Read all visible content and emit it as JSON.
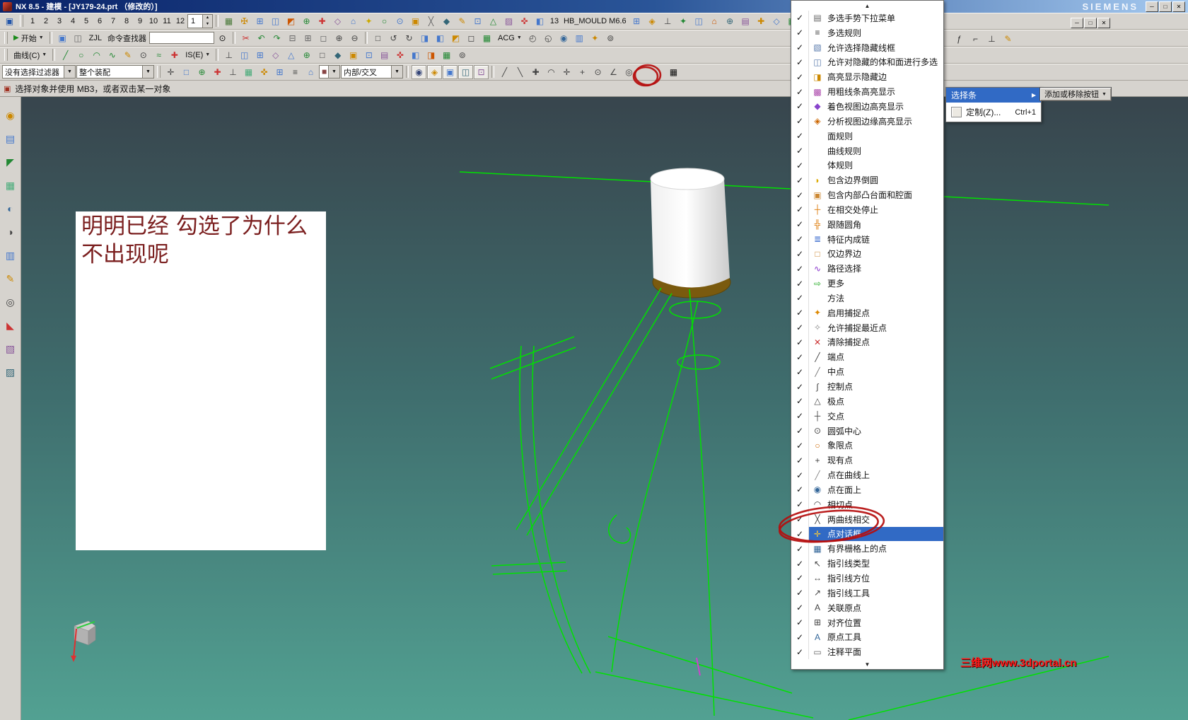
{
  "colors": {
    "highlight": "#316ac5",
    "wireframe": "#00e100",
    "annotation": "#b50d0d",
    "note_text": "#7b1f1f",
    "watermark": "#ff1a1a",
    "viewport_top": "#38454d",
    "viewport_mid": "#3f6e6e",
    "viewport_bottom": "#52a192"
  },
  "ui": {
    "dd_arrow": "▼",
    "spin_up": "▲",
    "spin_down": "▼",
    "start_glyph": "▶",
    "prompt_glyph": "▣",
    "search_glyph": "⊙"
  },
  "title_bar": {
    "app_title": "NX 8.5 - 建模 - [JY179-24.prt （修改的）]",
    "brand": "SIEMENS",
    "minimize": "─",
    "maximize": "□",
    "close": "✕"
  },
  "doc_window": {
    "minimize": "─",
    "restore": "□",
    "close": "✕"
  },
  "toolbar1": {
    "numbers": [
      "1",
      "2",
      "3",
      "4",
      "5",
      "6",
      "7",
      "8",
      "9",
      "10",
      "11",
      "12"
    ],
    "spinner_value": "1",
    "label_13": "13",
    "mould_label": "HB_MOULD M6.6",
    "icons_a": [
      {
        "g": "▦",
        "c": "#4a7a3a"
      },
      {
        "g": "✠",
        "c": "#cc8800"
      },
      {
        "g": "⊞",
        "c": "#4477cc"
      },
      {
        "g": "◫",
        "c": "#4477cc"
      },
      {
        "g": "◩",
        "c": "#cc5500"
      },
      {
        "g": "⊕",
        "c": "#228833"
      },
      {
        "g": "✚",
        "c": "#cc3333"
      },
      {
        "g": "◇",
        "c": "#885599"
      },
      {
        "g": "⌂",
        "c": "#4477cc"
      },
      {
        "g": "✦",
        "c": "#ccaa00"
      },
      {
        "g": "○",
        "c": "#228833"
      },
      {
        "g": "⊙",
        "c": "#4477cc"
      },
      {
        "g": "▣",
        "c": "#cc8800"
      },
      {
        "g": "╳",
        "c": "#666666"
      },
      {
        "g": "◆",
        "c": "#336677"
      },
      {
        "g": "✎",
        "c": "#cc8800"
      },
      {
        "g": "⊡",
        "c": "#4477cc"
      },
      {
        "g": "△",
        "c": "#228833"
      },
      {
        "g": "▨",
        "c": "#885599"
      },
      {
        "g": "✜",
        "c": "#cc3333"
      },
      {
        "g": "◧",
        "c": "#4477cc"
      }
    ],
    "icons_b": [
      {
        "g": "⊞",
        "c": "#4477cc"
      },
      {
        "g": "◈",
        "c": "#cc8800"
      },
      {
        "g": "⊥",
        "c": "#444444"
      },
      {
        "g": "✦",
        "c": "#228833"
      },
      {
        "g": "◫",
        "c": "#4477cc"
      },
      {
        "g": "⌂",
        "c": "#cc5500"
      },
      {
        "g": "⊕",
        "c": "#336677"
      },
      {
        "g": "▤",
        "c": "#885599"
      },
      {
        "g": "✚",
        "c": "#cc8800"
      },
      {
        "g": "◇",
        "c": "#4477cc"
      },
      {
        "g": "▦",
        "c": "#228833"
      }
    ]
  },
  "toolbar2": {
    "start_label": "开始",
    "zjl_label": "ZJL",
    "finder_label": "命令查找器",
    "acg_label": "ACG",
    "icons_a": [
      {
        "g": "▣",
        "c": "#4477cc"
      },
      {
        "g": "◫",
        "c": "#666666"
      }
    ],
    "icons_b": [
      {
        "g": "✂",
        "c": "#cc3333"
      },
      {
        "g": "↶",
        "c": "#228833"
      },
      {
        "g": "↷",
        "c": "#228833"
      },
      {
        "g": "⊟",
        "c": "#666666"
      },
      {
        "g": "⊞",
        "c": "#666666"
      },
      {
        "g": "◻",
        "c": "#666666"
      },
      {
        "g": "⊕",
        "c": "#444444"
      },
      {
        "g": "⊖",
        "c": "#444444"
      }
    ],
    "icons_c": [
      {
        "g": "□",
        "c": "#444444"
      },
      {
        "g": "↺",
        "c": "#444444"
      },
      {
        "g": "↻",
        "c": "#444444"
      },
      {
        "g": "◨",
        "c": "#4477cc"
      },
      {
        "g": "◧",
        "c": "#4477cc"
      },
      {
        "g": "◩",
        "c": "#cc8800"
      },
      {
        "g": "◻",
        "c": "#444444"
      },
      {
        "g": "▦",
        "c": "#228833"
      }
    ],
    "icons_d": [
      {
        "g": "◴",
        "c": "#444444"
      },
      {
        "g": "◵",
        "c": "#444444"
      },
      {
        "g": "◉",
        "c": "#336699"
      },
      {
        "g": "▥",
        "c": "#4477cc"
      },
      {
        "g": "✦",
        "c": "#cc8800"
      },
      {
        "g": "⊚",
        "c": "#444444"
      }
    ],
    "icons_right": [
      {
        "g": "ƒ",
        "c": "#333333"
      },
      {
        "g": "⌐",
        "c": "#333333"
      },
      {
        "g": "⊥",
        "c": "#333333"
      },
      {
        "g": "✎",
        "c": "#cc8800"
      }
    ]
  },
  "toolbar3": {
    "curve_label": "曲线(C)",
    "ise_label": "IS(E)",
    "icons_a": [
      {
        "g": "╱",
        "c": "#228833"
      },
      {
        "g": "○",
        "c": "#228833"
      },
      {
        "g": "◠",
        "c": "#228833"
      },
      {
        "g": "∿",
        "c": "#228833"
      },
      {
        "g": "✎",
        "c": "#cc8800"
      },
      {
        "g": "⊙",
        "c": "#444444"
      },
      {
        "g": "≈",
        "c": "#228833"
      },
      {
        "g": "✚",
        "c": "#cc3333"
      }
    ],
    "icons_b": [
      {
        "g": "⊥",
        "c": "#444444"
      },
      {
        "g": "◫",
        "c": "#4477cc"
      },
      {
        "g": "⊞",
        "c": "#4477cc"
      },
      {
        "g": "◇",
        "c": "#885599"
      },
      {
        "g": "△",
        "c": "#4477cc"
      },
      {
        "g": "⊕",
        "c": "#228833"
      },
      {
        "g": "□",
        "c": "#444444"
      },
      {
        "g": "◆",
        "c": "#336677"
      },
      {
        "g": "▣",
        "c": "#cc8800"
      },
      {
        "g": "⊡",
        "c": "#4477cc"
      },
      {
        "g": "▤",
        "c": "#885599"
      },
      {
        "g": "✜",
        "c": "#cc3333"
      },
      {
        "g": "◧",
        "c": "#4477cc"
      },
      {
        "g": "◨",
        "c": "#cc5500"
      },
      {
        "g": "▦",
        "c": "#228833"
      },
      {
        "g": "⊚",
        "c": "#444444"
      }
    ]
  },
  "selection_bar": {
    "filter_value": "没有选择过滤器",
    "scope_value": "整个装配",
    "mode_value": "内部/交叉",
    "swatch_glyph": "◼",
    "grid_icon": "▦",
    "icons_a": [
      {
        "g": "✛",
        "c": "#444444"
      },
      {
        "g": "□",
        "c": "#4477cc"
      },
      {
        "g": "⊕",
        "c": "#228833"
      },
      {
        "g": "✚",
        "c": "#cc3333"
      },
      {
        "g": "⊥",
        "c": "#444444"
      },
      {
        "g": "▦",
        "c": "#44aa77"
      },
      {
        "g": "✜",
        "c": "#cc8800"
      },
      {
        "g": "⊞",
        "c": "#4477cc"
      },
      {
        "g": "≡",
        "c": "#444444"
      },
      {
        "g": "⌂",
        "c": "#4477cc"
      }
    ],
    "icons_b": [
      {
        "g": "◉",
        "c": "#334477"
      },
      {
        "g": "◈",
        "c": "#cc8800"
      },
      {
        "g": "▣",
        "c": "#4477cc"
      },
      {
        "g": "◫",
        "c": "#336677"
      },
      {
        "g": "⊡",
        "c": "#885599"
      }
    ],
    "icons_c": [
      {
        "g": "╱",
        "c": "#444444"
      },
      {
        "g": "╲",
        "c": "#444444"
      },
      {
        "g": "✚",
        "c": "#444444"
      },
      {
        "g": "◠",
        "c": "#444444"
      },
      {
        "g": "✛",
        "c": "#444444"
      },
      {
        "g": "+",
        "c": "#444444"
      },
      {
        "g": "⊙",
        "c": "#444444"
      },
      {
        "g": "∠",
        "c": "#444444"
      },
      {
        "g": "◎",
        "c": "#444444"
      }
    ]
  },
  "prompt_bar": {
    "text": "选择对象并使用 MB3，或者双击某一对象"
  },
  "left_toolbar": {
    "icons": [
      {
        "g": "◉",
        "c": "#cc8800"
      },
      {
        "g": "▤",
        "c": "#4477cc"
      },
      {
        "g": "◤",
        "c": "#228833"
      },
      {
        "g": "▦",
        "c": "#44aa77"
      },
      {
        "g": "◐",
        "c": "#336699"
      },
      {
        "g": "◑",
        "c": "#444444"
      },
      {
        "g": "▥",
        "c": "#4477cc"
      },
      {
        "g": "✎",
        "c": "#cc8800"
      },
      {
        "g": "◎",
        "c": "#444444"
      },
      {
        "g": "◣",
        "c": "#cc3333"
      },
      {
        "g": "▧",
        "c": "#885599"
      },
      {
        "g": "▨",
        "c": "#336677"
      }
    ]
  },
  "note": {
    "text": "明明已经 勾选了为什么不出现呢"
  },
  "menu": {
    "check_glyph": "✓",
    "scroll_up": "▲",
    "scroll_down": "▼",
    "items": [
      {
        "label": "多选手势下拉菜单",
        "g": "▤",
        "c": "#666666",
        "checked": true
      },
      {
        "label": "多选规则",
        "g": "≡",
        "c": "#444444",
        "checked": true
      },
      {
        "label": "允许选择隐藏线框",
        "g": "▧",
        "c": "#5577aa",
        "checked": true
      },
      {
        "label": "允许对隐藏的体和面进行多选",
        "g": "◫",
        "c": "#5577aa",
        "checked": true
      },
      {
        "label": "高亮显示隐藏边",
        "g": "◨",
        "c": "#cc8800",
        "checked": true
      },
      {
        "label": "用粗线条高亮显示",
        "g": "▩",
        "c": "#aa44aa",
        "checked": true
      },
      {
        "label": "着色视图边高亮显示",
        "g": "◆",
        "c": "#8844cc",
        "checked": true
      },
      {
        "label": "分析视图边缘高亮显示",
        "g": "◈",
        "c": "#cc6600",
        "checked": true
      },
      {
        "label": "面规则",
        "g": "",
        "c": "",
        "checked": true
      },
      {
        "label": "曲线规则",
        "g": "",
        "c": "",
        "checked": true
      },
      {
        "label": "体规则",
        "g": "",
        "c": "",
        "checked": true
      },
      {
        "label": "包含边界倒圆",
        "g": "◗",
        "c": "#ddaa00",
        "checked": true
      },
      {
        "label": "包含内部凸台面和腔面",
        "g": "▣",
        "c": "#cc8833",
        "checked": true
      },
      {
        "label": "在相交处停止",
        "g": "┼",
        "c": "#dd7700",
        "checked": true
      },
      {
        "label": "跟随圆角",
        "g": "╬",
        "c": "#dd7700",
        "checked": true
      },
      {
        "label": "特征内成链",
        "g": "≣",
        "c": "#3366cc",
        "checked": true
      },
      {
        "label": "仅边界边",
        "g": "□",
        "c": "#cc8833",
        "checked": true
      },
      {
        "label": "路径选择",
        "g": "∿",
        "c": "#8833cc",
        "checked": true
      },
      {
        "label": "更多",
        "g": "⇨",
        "c": "#22aa22",
        "checked": true
      },
      {
        "label": "方法",
        "g": "",
        "c": "",
        "checked": true
      },
      {
        "label": "启用捕捉点",
        "g": "✦",
        "c": "#dd8800",
        "checked": true
      },
      {
        "label": "允许捕捉最近点",
        "g": "✧",
        "c": "#888888",
        "checked": true
      },
      {
        "label": "清除捕捉点",
        "g": "✕",
        "c": "#cc3333",
        "checked": true
      },
      {
        "label": "端点",
        "g": "╱",
        "c": "#444444",
        "checked": true
      },
      {
        "label": "中点",
        "g": "╱",
        "c": "#777777",
        "checked": true
      },
      {
        "label": "控制点",
        "g": "∫",
        "c": "#444444",
        "checked": true
      },
      {
        "label": "极点",
        "g": "△",
        "c": "#444444",
        "checked": true
      },
      {
        "label": "交点",
        "g": "┼",
        "c": "#444444",
        "checked": true
      },
      {
        "label": "圆弧中心",
        "g": "⊙",
        "c": "#444444",
        "checked": true
      },
      {
        "label": "象限点",
        "g": "○",
        "c": "#cc6600",
        "checked": true
      },
      {
        "label": "现有点",
        "g": "+",
        "c": "#444444",
        "checked": true
      },
      {
        "label": "点在曲线上",
        "g": "╱",
        "c": "#888888",
        "checked": true
      },
      {
        "label": "点在面上",
        "g": "◉",
        "c": "#336699",
        "checked": true
      },
      {
        "label": "相切点",
        "g": "◠",
        "c": "#444444",
        "checked": true
      },
      {
        "label": "两曲线相交",
        "g": "╳",
        "c": "#444444",
        "checked": true
      },
      {
        "label": "点对话框",
        "g": "✛",
        "c": "#ffcc33",
        "checked": true,
        "hl": true
      },
      {
        "label": "有界栅格上的点",
        "g": "▦",
        "c": "#336699",
        "checked": true
      },
      {
        "label": "指引线类型",
        "g": "↖",
        "c": "#444444",
        "checked": true
      },
      {
        "label": "指引线方位",
        "g": "↔",
        "c": "#444444",
        "checked": true
      },
      {
        "label": "指引线工具",
        "g": "↗",
        "c": "#444444",
        "checked": true
      },
      {
        "label": "关联原点",
        "g": "A",
        "c": "#444444",
        "checked": true
      },
      {
        "label": "对齐位置",
        "g": "⊞",
        "c": "#444444",
        "checked": true
      },
      {
        "label": "原点工具",
        "g": "A",
        "c": "#336699",
        "checked": true
      },
      {
        "label": "注释平面",
        "g": "▭",
        "c": "#666666",
        "checked": true
      }
    ]
  },
  "popup": {
    "select_bar_label": "选择条",
    "arrow": "▶",
    "customize_label": "定制(Z)...",
    "customize_shortcut": "Ctrl+1"
  },
  "add_remove": {
    "label": "添加或移除按钮",
    "arrow": "▼"
  },
  "watermark": {
    "text": "三维网www.3dportal.cn"
  }
}
